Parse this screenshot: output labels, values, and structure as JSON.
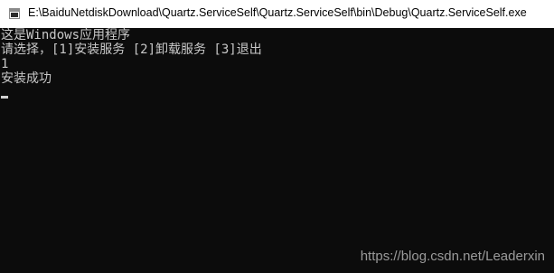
{
  "window": {
    "title": "E:\\BaiduNetdiskDownload\\Quartz.ServiceSelf\\Quartz.ServiceSelf\\bin\\Debug\\Quartz.ServiceSelf.exe",
    "icon": "console-app-icon"
  },
  "console": {
    "lines": [
      "这是Windows应用程序",
      "请选择，[1]安装服务 [2]卸载服务 [3]退出",
      "1",
      "安装成功"
    ]
  },
  "watermark": {
    "text": "https://blog.csdn.net/Leaderxin"
  },
  "colors": {
    "console_background": "#0c0c0c",
    "console_text": "#c8c8c8",
    "titlebar_background": "#ffffff"
  }
}
